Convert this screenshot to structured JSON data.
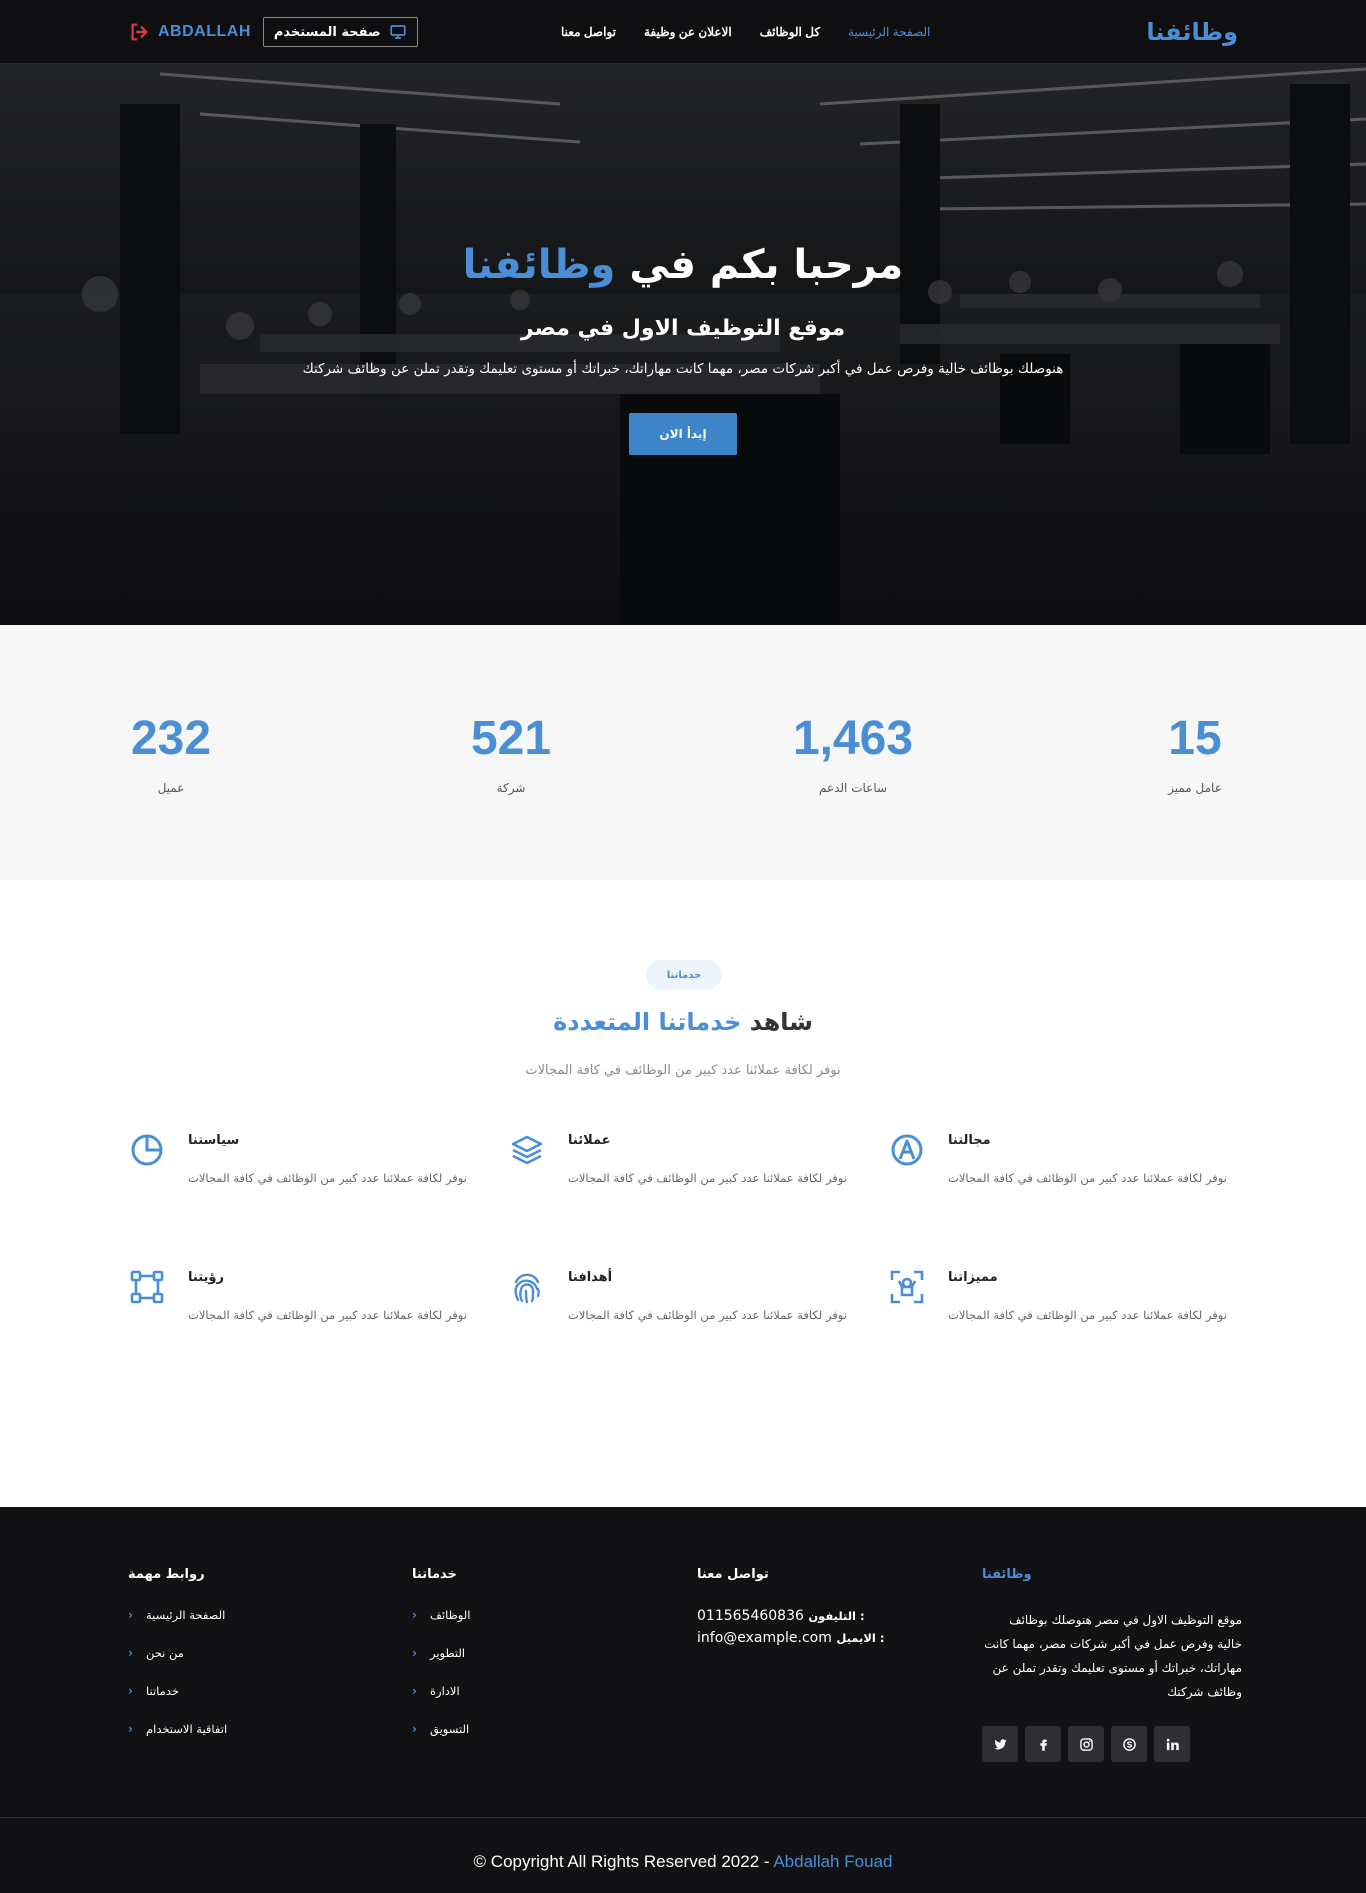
{
  "colors": {
    "accent": "#4a8fd6",
    "button": "#3d84c8",
    "nav_bg": "#0f0f11",
    "footer_bg": "#121214",
    "stats_bg": "#f7f7f7",
    "logout_icon": "#d83a3a"
  },
  "navbar": {
    "brand": "وظائفنا",
    "menu": [
      {
        "label": "الصفحة الرئيسية",
        "active": true
      },
      {
        "label": "كل الوظائف"
      },
      {
        "label": "الاعلان عن وظيفة"
      },
      {
        "label": "تواصل معنا"
      }
    ],
    "user_page_label": "صفحة المستخدم",
    "user_page_icon": "monitor-icon",
    "username": "ABDALLAH",
    "logout_icon": "sign-out-icon"
  },
  "hero": {
    "title_prefix": "مرحبا بكم في",
    "title_accent": "وظائفنا",
    "subtitle": "موقع التوظيف الاول في مصر",
    "description": "هنوصلك بوظائف خالية وفرص عمل في أكبر شركات مصر، مهما كانت مهاراتك، خبراتك أو مستوى تعليمك وتقدر تملن عن وظائف شركتك",
    "cta": "إبدأ الان"
  },
  "stats": [
    {
      "value": "232",
      "label": "عميل"
    },
    {
      "value": "521",
      "label": "شركة"
    },
    {
      "value": "1,463",
      "label": "ساعات الدعم"
    },
    {
      "value": "15",
      "label": "عامل مميز"
    }
  ],
  "services": {
    "pill": "خدماتنا",
    "title_prefix": "شاهد",
    "title_accent": "خدماتنا المتعددة",
    "subtitle": "نوفر لكافة عملائنا عدد كبير من الوظائف في كافة المجالات",
    "items": [
      {
        "name": "سياستنا",
        "desc": "نوفر لكافة عملائنا عدد كبير من الوظائف في كافة المجالات",
        "icon": "pie-chart-icon"
      },
      {
        "name": "عملائنا",
        "desc": "نوفر لكافة عملائنا عدد كبير من الوظائف في كافة المجالات",
        "icon": "layers-icon"
      },
      {
        "name": "مجالتنا",
        "desc": "نوفر لكافة عملائنا عدد كبير من الوظائف في كافة المجالات",
        "icon": "pen-nib-circle-icon"
      },
      {
        "name": "رؤيتنا",
        "desc": "نوفر لكافة عملائنا عدد كبير من الوظائف في كافة المجالات",
        "icon": "vector-square-icon"
      },
      {
        "name": "أهدافنا",
        "desc": "نوفر لكافة عملائنا عدد كبير من الوظائف في كافة المجالات",
        "icon": "fingerprint-icon"
      },
      {
        "name": "مميزاتنا",
        "desc": "نوفر لكافة عملائنا عدد كبير من الوظائف في كافة المجالات",
        "icon": "user-focus-icon"
      }
    ]
  },
  "footer": {
    "links_title": "روابط مهمة",
    "links": [
      "الصفحة الرئيسية",
      "من نحن",
      "خدماتنا",
      "اتفاقية الاستخدام"
    ],
    "services_title": "خدماتنا",
    "services": [
      "الوظائف",
      "التطوير",
      "الادارة",
      "التسويق"
    ],
    "contact_title": "تواصل معنا",
    "phone_label": "التليفون :",
    "phone": "011565460836",
    "email_label": "الايميل :",
    "email": "info@example.com",
    "brand": "وظائفنا",
    "about": "موقع التوظيف الاول في مصر هنوصلك بوظائف خالية وفرص عمل في أكبر شركات مصر، مهما كانت مهاراتك، خبراتك أو مستوى تعليمك وتقدر تملن عن وظائف شركتك",
    "socials": [
      "twitter-icon",
      "facebook-icon",
      "instagram-icon",
      "skype-icon",
      "linkedin-icon"
    ],
    "copyright_prefix": "© Copyright All Rights Reserved 2022 -",
    "copyright_author": "Abdallah Fouad"
  }
}
